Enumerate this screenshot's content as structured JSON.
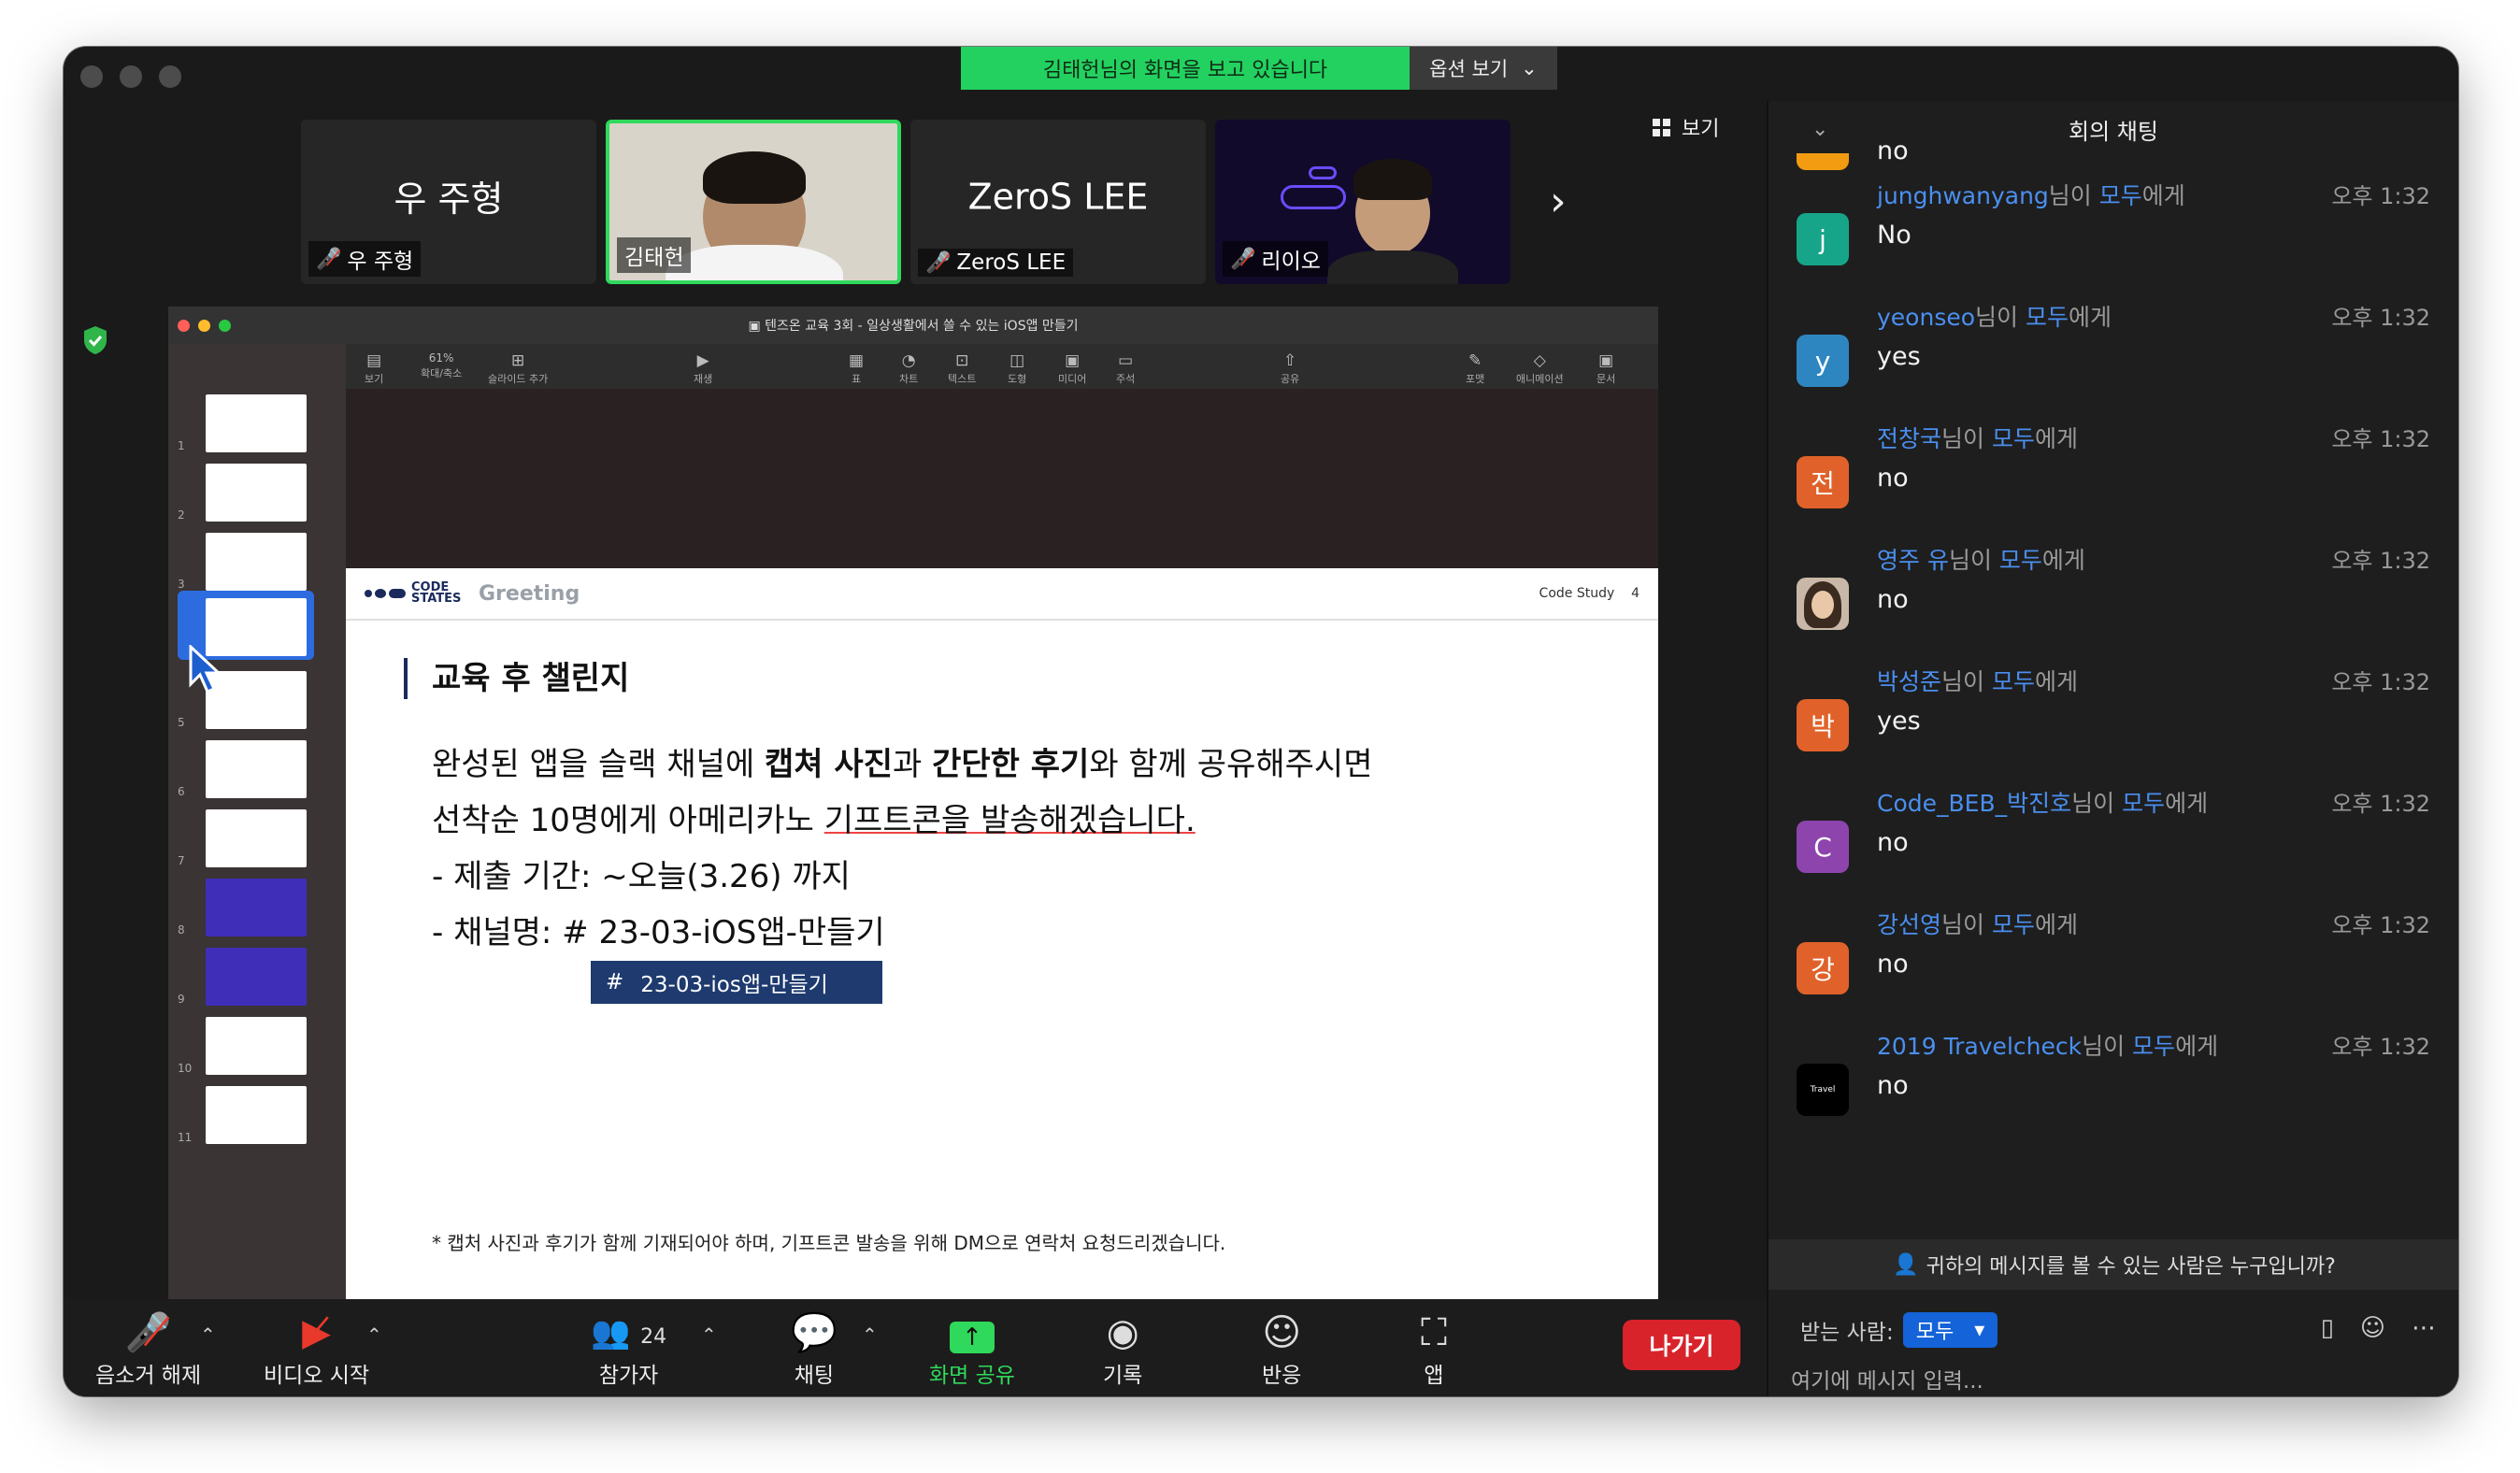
{
  "banner": {
    "sharing_text": "김태헌님의 화면을 보고 있습니다",
    "view_options": "옵션 보기"
  },
  "gallery": {
    "view_label": "보기",
    "tiles": [
      {
        "big_name": "우 주형",
        "name": "우 주형",
        "muted": true
      },
      {
        "big_name": "",
        "name": "김태헌",
        "muted": false
      },
      {
        "big_name": "ZeroS LEE",
        "name": "ZeroS LEE",
        "muted": true
      },
      {
        "big_name": "",
        "name": "리이오",
        "muted": true
      }
    ]
  },
  "keynote": {
    "window_title": "텐즈온 교육 3회 - 일상생활에서 쓸 수 있는 iOS앱 만들기",
    "toolbar": [
      {
        "label": "보기",
        "icon": "sidebar-icon"
      },
      {
        "label": "확대/축소",
        "icon": "zoom-icon",
        "value": "61%"
      },
      {
        "label": "슬라이드 추가",
        "icon": "add-slide-icon"
      },
      {
        "label": "재생",
        "icon": "play-icon"
      },
      {
        "label": "표",
        "icon": "table-icon"
      },
      {
        "label": "차트",
        "icon": "chart-icon"
      },
      {
        "label": "텍스트",
        "icon": "text-icon"
      },
      {
        "label": "도형",
        "icon": "shape-icon"
      },
      {
        "label": "미디어",
        "icon": "media-icon"
      },
      {
        "label": "주석",
        "icon": "comment-icon"
      },
      {
        "label": "공유",
        "icon": "share-icon"
      },
      {
        "label": "포맷",
        "icon": "format-icon"
      },
      {
        "label": "애니메이션",
        "icon": "animate-icon"
      },
      {
        "label": "문서",
        "icon": "document-icon"
      }
    ],
    "slide_numbers": [
      "1",
      "2",
      "3",
      "4",
      "5",
      "6",
      "7",
      "8",
      "9",
      "10",
      "11"
    ],
    "slide": {
      "logo_text": "CODE STATES",
      "section": "Greeting",
      "header_right": "Code Study",
      "page_num": "4",
      "title": "교육 후 챌린지",
      "line1_a": "완성된 앱을 슬랙 채널에 ",
      "line1_b": "캡쳐 사진",
      "line1_c": "과 ",
      "line1_d": "간단한 후기",
      "line1_e": "와 함께 공유해주시면",
      "line2_a": "선착순 10명에게 아메리카노 ",
      "line2_b": "기프트콘",
      "line2_c": "을 발송해겠습니다.",
      "bullet1": "-  제출 기간: ~오늘(3.26) 까지",
      "bullet2": "-  채널명: # 23-03-iOS앱-만들기",
      "channel_hash": "#",
      "channel_tag": "23-03-ios앱-만들기",
      "footnote": "* 캡처 사진과 후기가 함께 기재되어야 하며, 기프트콘 발송을 위해 DM으로 연락처 요청드리겠습니다."
    }
  },
  "controls": {
    "unmute": "음소거 해제",
    "video": "비디오 시작",
    "participants": "참가자",
    "participant_count": "24",
    "chat": "채팅",
    "share": "화면 공유",
    "record": "기록",
    "reactions": "반응",
    "apps": "앱",
    "leave": "나가기"
  },
  "chat": {
    "title": "회의 채팅",
    "partial_text": "no",
    "messages": [
      {
        "sender": "junghwanyang",
        "suffix": "님이 ",
        "to": "모두",
        "to_suffix": "에게",
        "time": "오후 1:32",
        "avatar": "j",
        "avatar_color": "#17a589",
        "text": "No"
      },
      {
        "sender": "yeonseo",
        "suffix": "님이 ",
        "to": "모두",
        "to_suffix": "에게",
        "time": "오후 1:32",
        "avatar": "y",
        "avatar_color": "#2e86c1",
        "text": "yes"
      },
      {
        "sender": "전창국",
        "suffix": "님이 ",
        "to": "모두",
        "to_suffix": "에게",
        "time": "오후 1:32",
        "avatar": "전",
        "avatar_color": "#e0622a",
        "text": "no"
      },
      {
        "sender": "영주 유",
        "suffix": "님이 ",
        "to": "모두",
        "to_suffix": "에게",
        "time": "오후 1:32",
        "avatar": "",
        "avatar_color": "#c9b8a8",
        "text": "no"
      },
      {
        "sender": "박성준",
        "suffix": "님이 ",
        "to": "모두",
        "to_suffix": "에게",
        "time": "오후 1:32",
        "avatar": "박",
        "avatar_color": "#e0622a",
        "text": "yes"
      },
      {
        "sender": "Code_BEB_박진호",
        "suffix": "님이 ",
        "to": "모두",
        "to_suffix": "에게",
        "time": "오후 1:32",
        "avatar": "C",
        "avatar_color": "#8e44ad",
        "text": "no"
      },
      {
        "sender": "강선영",
        "suffix": "님이 ",
        "to": "모두",
        "to_suffix": "에게",
        "time": "오후 1:32",
        "avatar": "강",
        "avatar_color": "#e0622a",
        "text": "no"
      },
      {
        "sender": "2019 Travelcheck",
        "suffix": "님이 ",
        "to": "모두",
        "to_suffix": "에게",
        "time": "오후 1:32",
        "avatar": "Travel",
        "avatar_color": "#000000",
        "text": "no"
      }
    ],
    "who_can_see": "귀하의 메시지를 볼 수 있는 사람은 누구입니까?",
    "to_label": "받는 사람:",
    "to_value": "모두",
    "input_placeholder": "여기에 메시지 입력..."
  },
  "colors": {
    "share_green": "#23d160",
    "leave_red": "#d8232b",
    "link_blue": "#4a8ff0",
    "slide_navy": "#1a2a5c"
  }
}
